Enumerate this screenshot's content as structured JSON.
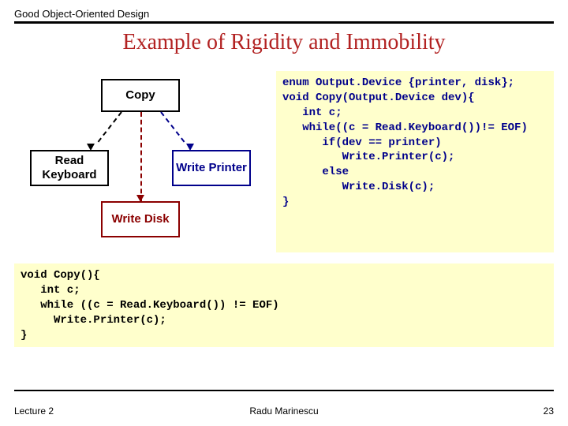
{
  "header": "Good Object-Oriented Design",
  "title": "Example of Rigidity and Immobility",
  "boxes": {
    "copy": "Copy",
    "read": "Read\nKeyboard",
    "write_printer": "Write\nPrinter",
    "write_disk": "Write\nDisk"
  },
  "code_top": "enum Output.Device {printer, disk};\nvoid Copy(Output.Device dev){\n   int c;\n   while((c = Read.Keyboard())!= EOF)\n      if(dev == printer)\n         Write.Printer(c);\n      else\n         Write.Disk(c);\n}",
  "code_bottom": "void Copy(){\n   int c;\n   while ((c = Read.Keyboard()) != EOF)\n     Write.Printer(c);\n}",
  "footer": {
    "left": "Lecture 2",
    "center": "Radu Marinescu",
    "right": "23"
  }
}
